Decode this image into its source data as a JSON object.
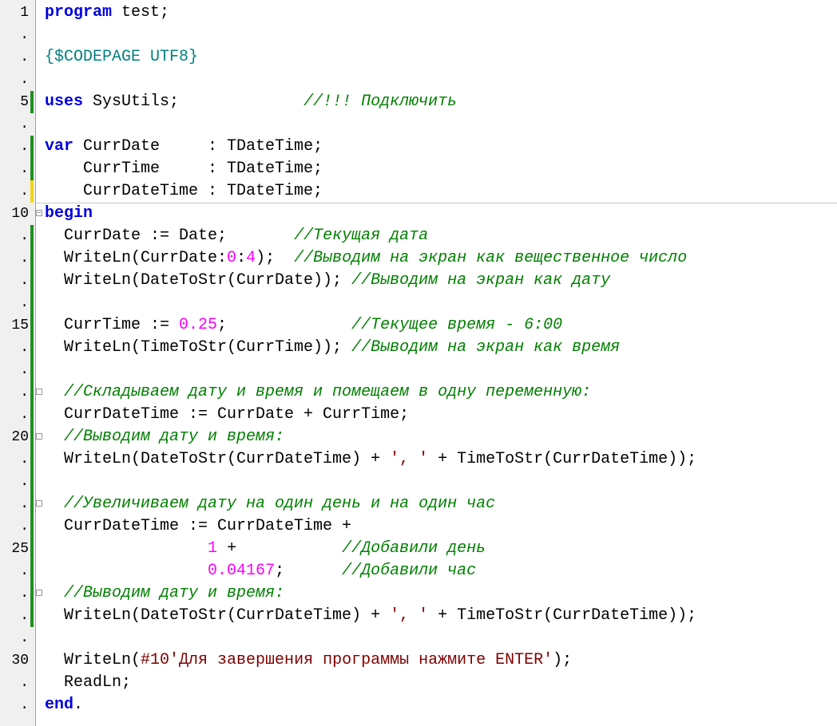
{
  "colors": {
    "keyword": "#0000e0",
    "directive": "#008080",
    "comment": "#008000",
    "number": "#ff00ff",
    "string": "#800000",
    "plain": "#000000",
    "gutter_bg": "#f0f0f0",
    "change_saved": "#1f8f1f",
    "change_unsaved": "#f2d31b"
  },
  "lines": [
    {
      "ln": "1",
      "change": "",
      "fold": "",
      "tokens": [
        [
          "kw",
          "program"
        ],
        [
          "plain",
          " test;"
        ]
      ]
    },
    {
      "ln": ".",
      "change": "",
      "fold": "",
      "tokens": []
    },
    {
      "ln": ".",
      "change": "",
      "fold": "",
      "tokens": [
        [
          "dir",
          "{$CODEPAGE UTF8}"
        ]
      ]
    },
    {
      "ln": ".",
      "change": "",
      "fold": "",
      "tokens": []
    },
    {
      "ln": "5",
      "change": "saved",
      "fold": "",
      "tokens": [
        [
          "kw",
          "uses"
        ],
        [
          "plain",
          " SysUtils;             "
        ],
        [
          "cm",
          "//!!! Подключить"
        ]
      ]
    },
    {
      "ln": ".",
      "change": "",
      "fold": "",
      "tokens": []
    },
    {
      "ln": ".",
      "change": "saved",
      "fold": "",
      "tokens": [
        [
          "kw",
          "var"
        ],
        [
          "plain",
          " CurrDate     : TDateTime;"
        ]
      ]
    },
    {
      "ln": ".",
      "change": "saved",
      "fold": "",
      "tokens": [
        [
          "plain",
          "    CurrTime     : TDateTime;"
        ]
      ]
    },
    {
      "ln": ".",
      "change": "unsaved",
      "fold": "",
      "tokens": [
        [
          "plain",
          "    CurrDateTime : TDateTime;"
        ]
      ]
    },
    {
      "ln": "10",
      "change": "",
      "fold": "minus",
      "tokens": [
        [
          "kw",
          "begin"
        ]
      ]
    },
    {
      "ln": ".",
      "change": "saved",
      "fold": "",
      "tokens": [
        [
          "plain",
          "  CurrDate := Date;       "
        ],
        [
          "cm",
          "//Текущая дата"
        ]
      ]
    },
    {
      "ln": ".",
      "change": "saved",
      "fold": "",
      "tokens": [
        [
          "plain",
          "  WriteLn(CurrDate:"
        ],
        [
          "num",
          "0"
        ],
        [
          "plain",
          ":"
        ],
        [
          "num",
          "4"
        ],
        [
          "plain",
          ");  "
        ],
        [
          "cm",
          "//Выводим на экран как вещественное число"
        ]
      ]
    },
    {
      "ln": ".",
      "change": "saved",
      "fold": "",
      "tokens": [
        [
          "plain",
          "  WriteLn(DateToStr(CurrDate)); "
        ],
        [
          "cm",
          "//Выводим на экран как дату"
        ]
      ]
    },
    {
      "ln": ".",
      "change": "saved",
      "fold": "",
      "tokens": []
    },
    {
      "ln": "15",
      "change": "saved",
      "fold": "",
      "tokens": [
        [
          "plain",
          "  CurrTime := "
        ],
        [
          "num",
          "0.25"
        ],
        [
          "plain",
          ";             "
        ],
        [
          "cm",
          "//Текущее время - 6:00"
        ]
      ]
    },
    {
      "ln": ".",
      "change": "saved",
      "fold": "",
      "tokens": [
        [
          "plain",
          "  WriteLn(TimeToStr(CurrTime)); "
        ],
        [
          "cm",
          "//Выводим на экран как время"
        ]
      ]
    },
    {
      "ln": ".",
      "change": "saved",
      "fold": "",
      "tokens": []
    },
    {
      "ln": ".",
      "change": "saved",
      "fold": "box",
      "tokens": [
        [
          "cm",
          "  //Складываем дату и время и помещаем в одну переменную:"
        ]
      ]
    },
    {
      "ln": ".",
      "change": "saved",
      "fold": "",
      "tokens": [
        [
          "plain",
          "  CurrDateTime := CurrDate + CurrTime;"
        ]
      ]
    },
    {
      "ln": "20",
      "change": "saved",
      "fold": "box",
      "tokens": [
        [
          "cm",
          "  //Выводим дату и время:"
        ]
      ]
    },
    {
      "ln": ".",
      "change": "saved",
      "fold": "",
      "tokens": [
        [
          "plain",
          "  WriteLn(DateToStr(CurrDateTime) + "
        ],
        [
          "ch",
          "', '"
        ],
        [
          "plain",
          " + TimeToStr(CurrDateTime));"
        ]
      ]
    },
    {
      "ln": ".",
      "change": "saved",
      "fold": "",
      "tokens": []
    },
    {
      "ln": ".",
      "change": "saved",
      "fold": "box",
      "tokens": [
        [
          "cm",
          "  //Увеличиваем дату на один день и на один час"
        ]
      ]
    },
    {
      "ln": ".",
      "change": "saved",
      "fold": "",
      "tokens": [
        [
          "plain",
          "  CurrDateTime := CurrDateTime +"
        ]
      ]
    },
    {
      "ln": "25",
      "change": "saved",
      "fold": "",
      "tokens": [
        [
          "plain",
          "                 "
        ],
        [
          "num",
          "1"
        ],
        [
          "plain",
          " +           "
        ],
        [
          "cm",
          "//Добавили день"
        ]
      ]
    },
    {
      "ln": ".",
      "change": "saved",
      "fold": "",
      "tokens": [
        [
          "plain",
          "                 "
        ],
        [
          "num",
          "0.04167"
        ],
        [
          "plain",
          ";      "
        ],
        [
          "cm",
          "//Добавили час"
        ]
      ]
    },
    {
      "ln": ".",
      "change": "saved",
      "fold": "box",
      "tokens": [
        [
          "cm",
          "  //Выводим дату и время:"
        ]
      ]
    },
    {
      "ln": ".",
      "change": "saved",
      "fold": "",
      "tokens": [
        [
          "plain",
          "  WriteLn(DateToStr(CurrDateTime) + "
        ],
        [
          "ch",
          "', '"
        ],
        [
          "plain",
          " + TimeToStr(CurrDateTime));"
        ]
      ]
    },
    {
      "ln": ".",
      "change": "",
      "fold": "",
      "tokens": []
    },
    {
      "ln": "30",
      "change": "",
      "fold": "",
      "tokens": [
        [
          "plain",
          "  WriteLn("
        ],
        [
          "str",
          "#10'Для завершения программы нажмите ENTER'"
        ],
        [
          "plain",
          ");"
        ]
      ]
    },
    {
      "ln": ".",
      "change": "",
      "fold": "",
      "tokens": [
        [
          "plain",
          "  ReadLn;"
        ]
      ]
    },
    {
      "ln": ".",
      "change": "",
      "fold": "",
      "tokens": [
        [
          "kw",
          "end"
        ],
        [
          "plain",
          "."
        ]
      ]
    }
  ]
}
